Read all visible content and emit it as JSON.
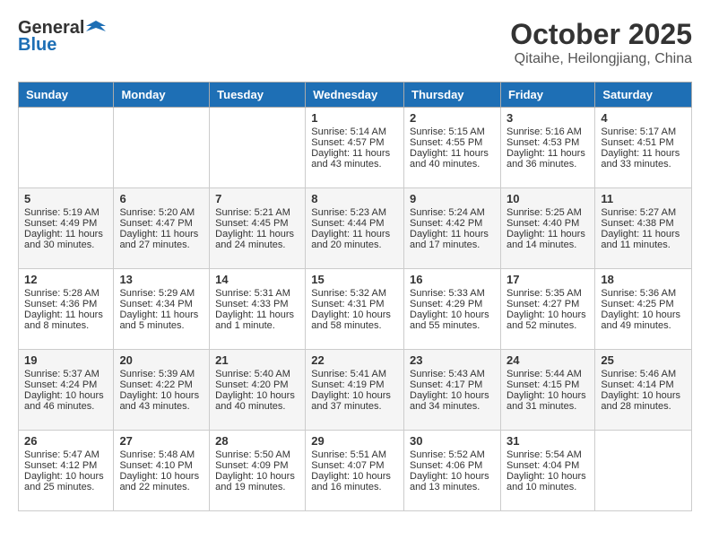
{
  "header": {
    "logo": {
      "general": "General",
      "blue": "Blue"
    },
    "title": "October 2025",
    "location": "Qitaihe, Heilongjiang, China"
  },
  "weekdays": [
    "Sunday",
    "Monday",
    "Tuesday",
    "Wednesday",
    "Thursday",
    "Friday",
    "Saturday"
  ],
  "weeks": [
    [
      {
        "day": null
      },
      {
        "day": null
      },
      {
        "day": null
      },
      {
        "day": 1,
        "sunrise": "Sunrise: 5:14 AM",
        "sunset": "Sunset: 4:57 PM",
        "daylight": "Daylight: 11 hours and 43 minutes."
      },
      {
        "day": 2,
        "sunrise": "Sunrise: 5:15 AM",
        "sunset": "Sunset: 4:55 PM",
        "daylight": "Daylight: 11 hours and 40 minutes."
      },
      {
        "day": 3,
        "sunrise": "Sunrise: 5:16 AM",
        "sunset": "Sunset: 4:53 PM",
        "daylight": "Daylight: 11 hours and 36 minutes."
      },
      {
        "day": 4,
        "sunrise": "Sunrise: 5:17 AM",
        "sunset": "Sunset: 4:51 PM",
        "daylight": "Daylight: 11 hours and 33 minutes."
      }
    ],
    [
      {
        "day": 5,
        "sunrise": "Sunrise: 5:19 AM",
        "sunset": "Sunset: 4:49 PM",
        "daylight": "Daylight: 11 hours and 30 minutes."
      },
      {
        "day": 6,
        "sunrise": "Sunrise: 5:20 AM",
        "sunset": "Sunset: 4:47 PM",
        "daylight": "Daylight: 11 hours and 27 minutes."
      },
      {
        "day": 7,
        "sunrise": "Sunrise: 5:21 AM",
        "sunset": "Sunset: 4:45 PM",
        "daylight": "Daylight: 11 hours and 24 minutes."
      },
      {
        "day": 8,
        "sunrise": "Sunrise: 5:23 AM",
        "sunset": "Sunset: 4:44 PM",
        "daylight": "Daylight: 11 hours and 20 minutes."
      },
      {
        "day": 9,
        "sunrise": "Sunrise: 5:24 AM",
        "sunset": "Sunset: 4:42 PM",
        "daylight": "Daylight: 11 hours and 17 minutes."
      },
      {
        "day": 10,
        "sunrise": "Sunrise: 5:25 AM",
        "sunset": "Sunset: 4:40 PM",
        "daylight": "Daylight: 11 hours and 14 minutes."
      },
      {
        "day": 11,
        "sunrise": "Sunrise: 5:27 AM",
        "sunset": "Sunset: 4:38 PM",
        "daylight": "Daylight: 11 hours and 11 minutes."
      }
    ],
    [
      {
        "day": 12,
        "sunrise": "Sunrise: 5:28 AM",
        "sunset": "Sunset: 4:36 PM",
        "daylight": "Daylight: 11 hours and 8 minutes."
      },
      {
        "day": 13,
        "sunrise": "Sunrise: 5:29 AM",
        "sunset": "Sunset: 4:34 PM",
        "daylight": "Daylight: 11 hours and 5 minutes."
      },
      {
        "day": 14,
        "sunrise": "Sunrise: 5:31 AM",
        "sunset": "Sunset: 4:33 PM",
        "daylight": "Daylight: 11 hours and 1 minute."
      },
      {
        "day": 15,
        "sunrise": "Sunrise: 5:32 AM",
        "sunset": "Sunset: 4:31 PM",
        "daylight": "Daylight: 10 hours and 58 minutes."
      },
      {
        "day": 16,
        "sunrise": "Sunrise: 5:33 AM",
        "sunset": "Sunset: 4:29 PM",
        "daylight": "Daylight: 10 hours and 55 minutes."
      },
      {
        "day": 17,
        "sunrise": "Sunrise: 5:35 AM",
        "sunset": "Sunset: 4:27 PM",
        "daylight": "Daylight: 10 hours and 52 minutes."
      },
      {
        "day": 18,
        "sunrise": "Sunrise: 5:36 AM",
        "sunset": "Sunset: 4:25 PM",
        "daylight": "Daylight: 10 hours and 49 minutes."
      }
    ],
    [
      {
        "day": 19,
        "sunrise": "Sunrise: 5:37 AM",
        "sunset": "Sunset: 4:24 PM",
        "daylight": "Daylight: 10 hours and 46 minutes."
      },
      {
        "day": 20,
        "sunrise": "Sunrise: 5:39 AM",
        "sunset": "Sunset: 4:22 PM",
        "daylight": "Daylight: 10 hours and 43 minutes."
      },
      {
        "day": 21,
        "sunrise": "Sunrise: 5:40 AM",
        "sunset": "Sunset: 4:20 PM",
        "daylight": "Daylight: 10 hours and 40 minutes."
      },
      {
        "day": 22,
        "sunrise": "Sunrise: 5:41 AM",
        "sunset": "Sunset: 4:19 PM",
        "daylight": "Daylight: 10 hours and 37 minutes."
      },
      {
        "day": 23,
        "sunrise": "Sunrise: 5:43 AM",
        "sunset": "Sunset: 4:17 PM",
        "daylight": "Daylight: 10 hours and 34 minutes."
      },
      {
        "day": 24,
        "sunrise": "Sunrise: 5:44 AM",
        "sunset": "Sunset: 4:15 PM",
        "daylight": "Daylight: 10 hours and 31 minutes."
      },
      {
        "day": 25,
        "sunrise": "Sunrise: 5:46 AM",
        "sunset": "Sunset: 4:14 PM",
        "daylight": "Daylight: 10 hours and 28 minutes."
      }
    ],
    [
      {
        "day": 26,
        "sunrise": "Sunrise: 5:47 AM",
        "sunset": "Sunset: 4:12 PM",
        "daylight": "Daylight: 10 hours and 25 minutes."
      },
      {
        "day": 27,
        "sunrise": "Sunrise: 5:48 AM",
        "sunset": "Sunset: 4:10 PM",
        "daylight": "Daylight: 10 hours and 22 minutes."
      },
      {
        "day": 28,
        "sunrise": "Sunrise: 5:50 AM",
        "sunset": "Sunset: 4:09 PM",
        "daylight": "Daylight: 10 hours and 19 minutes."
      },
      {
        "day": 29,
        "sunrise": "Sunrise: 5:51 AM",
        "sunset": "Sunset: 4:07 PM",
        "daylight": "Daylight: 10 hours and 16 minutes."
      },
      {
        "day": 30,
        "sunrise": "Sunrise: 5:52 AM",
        "sunset": "Sunset: 4:06 PM",
        "daylight": "Daylight: 10 hours and 13 minutes."
      },
      {
        "day": 31,
        "sunrise": "Sunrise: 5:54 AM",
        "sunset": "Sunset: 4:04 PM",
        "daylight": "Daylight: 10 hours and 10 minutes."
      },
      {
        "day": null
      }
    ]
  ]
}
